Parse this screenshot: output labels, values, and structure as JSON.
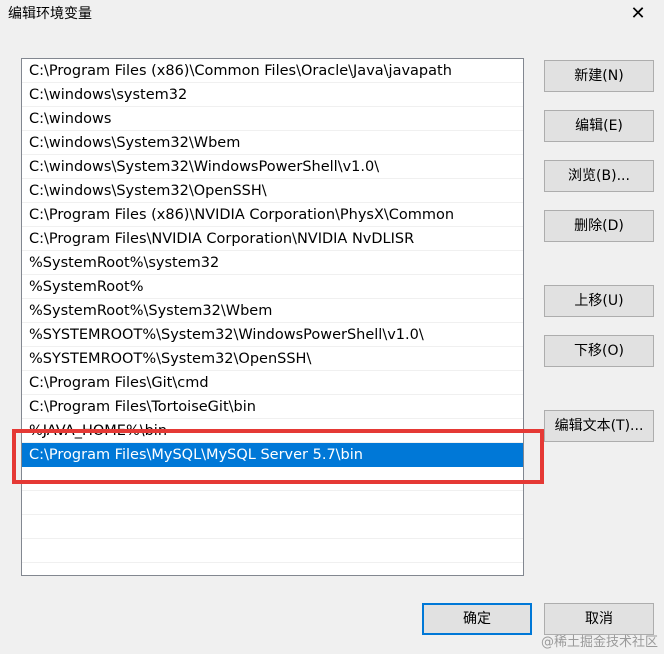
{
  "window": {
    "title": "编辑环境变量",
    "close_glyph": "✕"
  },
  "paths": [
    "C:\\Program Files (x86)\\Common Files\\Oracle\\Java\\javapath",
    "C:\\windows\\system32",
    "C:\\windows",
    "C:\\windows\\System32\\Wbem",
    "C:\\windows\\System32\\WindowsPowerShell\\v1.0\\",
    "C:\\windows\\System32\\OpenSSH\\",
    "C:\\Program Files (x86)\\NVIDIA Corporation\\PhysX\\Common",
    "C:\\Program Files\\NVIDIA Corporation\\NVIDIA NvDLISR",
    "%SystemRoot%\\system32",
    "%SystemRoot%",
    "%SystemRoot%\\System32\\Wbem",
    "%SYSTEMROOT%\\System32\\WindowsPowerShell\\v1.0\\",
    "%SYSTEMROOT%\\System32\\OpenSSH\\",
    "C:\\Program Files\\Git\\cmd",
    "C:\\Program Files\\TortoiseGit\\bin",
    "%JAVA_HOME%\\bin",
    "C:\\Program Files\\MySQL\\MySQL Server 5.7\\bin"
  ],
  "selected_index": 16,
  "empty_rows": 5,
  "buttons": {
    "new": "新建(N)",
    "edit": "编辑(E)",
    "browse": "浏览(B)...",
    "delete": "删除(D)",
    "move_up": "上移(U)",
    "move_down": "下移(O)",
    "edit_text": "编辑文本(T)...",
    "ok": "确定",
    "cancel": "取消"
  },
  "watermark": "@稀土掘金技术社区",
  "colors": {
    "selection": "#0078d7",
    "highlight_box": "#e53935"
  }
}
